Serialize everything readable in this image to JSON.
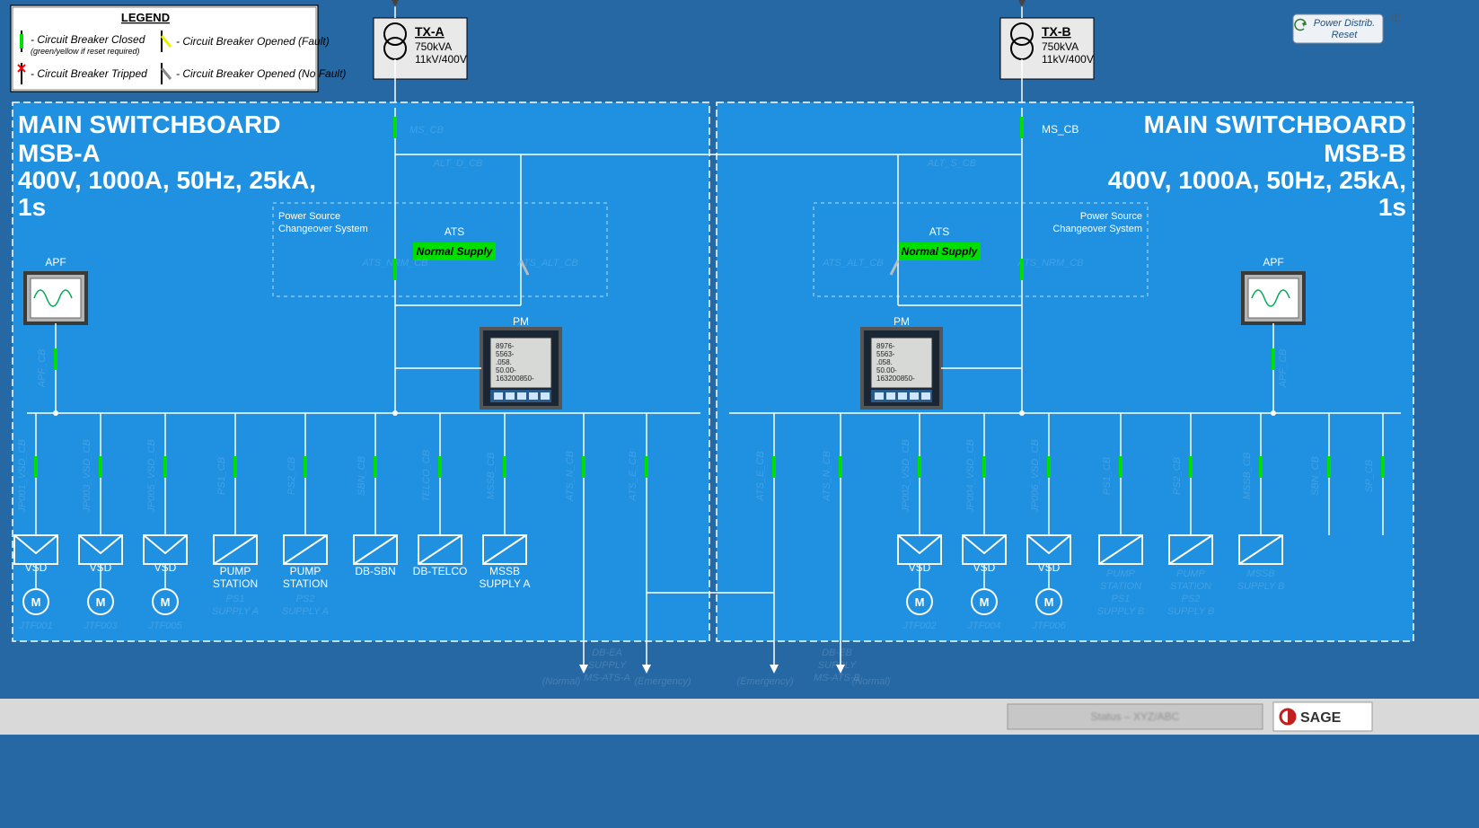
{
  "button": {
    "power_reset": "Power Distrib.\nReset"
  },
  "legend": {
    "title": "LEGEND",
    "closed": "- Circuit Breaker Closed",
    "closed_sub": "(green/yellow if reset required)",
    "opened_fault": "- Circuit Breaker Opened (Fault)",
    "tripped": "- Circuit Breaker Tripped",
    "opened_nofault": "- Circuit Breaker Opened (No Fault)"
  },
  "tx": {
    "a": {
      "name": "TX-A",
      "spec1": "750kVA",
      "spec2": "11kV/400V"
    },
    "b": {
      "name": "TX-B",
      "spec1": "750kVA",
      "spec2": "11kV/400V"
    }
  },
  "msb": {
    "a": {
      "line1": "MAIN SWITCHBOARD",
      "line2": "MSB-A",
      "line3": "400V, 1000A, 50Hz, 25kA,",
      "line4": "1s"
    },
    "b": {
      "line1": "MAIN SWITCHBOARD",
      "line2": "MSB-B",
      "line3": "400V, 1000A, 50Hz, 25kA,",
      "line4": "1s",
      "cb": "MS_CB"
    }
  },
  "pcs": {
    "line1": "Power Source",
    "line2": "Changeover System",
    "ats": "ATS",
    "normal": "Normal Supply",
    "pm": "PM"
  },
  "apf": "APF",
  "loadsA": {
    "vsd1": "VSD",
    "vsd2": "VSD",
    "vsd3": "VSD",
    "ps1_a": "PUMP",
    "ps1_b": "STATION",
    "ps2_a": "PUMP",
    "ps2_b": "STATION",
    "dbsbn": "DB-SBN",
    "dbtelco": "DB-TELCO",
    "mssb_a": "MSSB",
    "mssb_b": "SUPPLY A"
  },
  "loadsB": {
    "vsd1": "VSD",
    "vsd2": "VSD",
    "vsd3": "VSD"
  },
  "motor": "M",
  "footer": {
    "brand": "SAGE"
  }
}
